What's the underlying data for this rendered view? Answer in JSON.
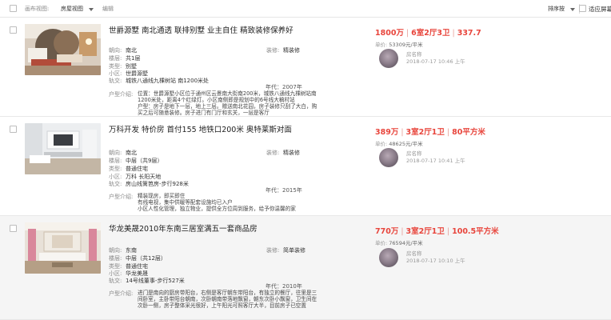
{
  "toolbar": {
    "gallery_label": "画布视图:",
    "view_label": "房屋视图",
    "edit_label": "编辑",
    "sort_label": "排序按",
    "fit_label": "适应屏幕"
  },
  "field_labels": {
    "orientation": "朝向:",
    "floor": "楼层:",
    "type": "类型:",
    "district": "小区:",
    "metro": "轨交:",
    "decor": "装修:",
    "intro": "户型介绍:",
    "unit_price": "单价:"
  },
  "listings": [
    {
      "title": "世爵源墅 南北通透 联排别墅 业主自住 精致装修保养好",
      "orientation": "南北",
      "floor": "共1层",
      "type": "别墅",
      "district": "世爵源墅",
      "metro": "城铁八通线九棵树站 南1200米处",
      "decor": "精装修",
      "year": "年代：2007年",
      "intro_lines": [
        "位置：世爵源墅小区位于通州区云景南大街南200米，城铁八通线九棵树站南",
        "1200米处，距离4个红绿灯。小区南侧即是规划中的6号线大稿村站",
        "户型：房子是地下一层，地上三层。赠送南北花园，房子装修只刮了大白，购",
        "买之后可随意装修。房子进门有门厅和玄关，一层是客厅"
      ],
      "price": "1800万",
      "layout": "6室2厅3卫",
      "area": "337.7",
      "unit_price": "53309元/平米",
      "agent": "房名称",
      "time": "2018-07-17 10:46 上午"
    },
    {
      "title": "万科开发 特价房 首付155 地铁口200米 奥特莱斯对面",
      "orientation": "南北",
      "floor": "中层（共9层）",
      "type": "普通住宅",
      "district": "万科 长阳天地",
      "metro": "房山线篱笆房-步行928米",
      "decor": "精装修",
      "year": "年代：2015年",
      "intro_lines": [
        "精装现房，即买即住",
        "有线电视，集中供暖等配套设施均已入户",
        "小区人性化管理，独立物业，提供全方位周到服务，给予你温馨的家"
      ],
      "price": "389万",
      "layout": "3室2厅1卫",
      "area": "80平方米",
      "unit_price": "48625元/平米",
      "agent": "房名称",
      "time": "2018-07-17 10:41 上午"
    },
    {
      "title": "华龙美晟2010年东南三居室满五一套商品房",
      "orientation": "东南",
      "floor": "中层（共12层）",
      "type": "普通住宅",
      "district": "华龙美晟",
      "metro": "14号线董事-步行527米",
      "decor": "简单装修",
      "year": "年代：2010年",
      "intro_lines": [
        "进门是南向的厨房带阳台，右侧是客厅朝东带阳台，有独立的餐厅，往里是三",
        "间卧室，主卧带阳台朝南，次卧朝南带落地飘窗，朝东次卧小飘窗，卫生间在",
        "次卧一侧，房子整体采光很好，上午阳光可照客厅大半，目前房子已空置"
      ],
      "price": "770万",
      "layout": "3室2厅1卫",
      "area": "100.5平方米",
      "unit_price": "76594元/平米",
      "agent": "房名称",
      "time": "2018-07-17 10:10 上午"
    }
  ]
}
